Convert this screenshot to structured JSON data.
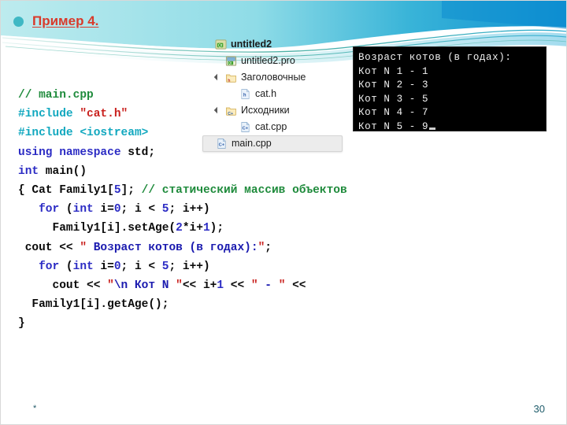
{
  "slide": {
    "title": "Пример 4.",
    "bullet_color": "#3FB8C4",
    "title_color": "#D93A2B",
    "footer_star": "*",
    "page_number": "30",
    "banner_colors": {
      "cyan_light": "#B7E9EC",
      "cyan_mid": "#34B9D6",
      "blue": "#0A8FD0",
      "teal_line": "#1F9E8F"
    }
  },
  "code": {
    "language": "cpp",
    "lines": [
      [
        {
          "t": "// main.cpp",
          "c": "c-comment"
        }
      ],
      [
        {
          "t": "#include ",
          "c": "c-pre"
        },
        {
          "t": "\"cat.h\"",
          "c": "c-str"
        }
      ],
      [
        {
          "t": "#include ",
          "c": "c-pre"
        },
        {
          "t": "<iostream>",
          "c": "c-pre"
        }
      ],
      [
        {
          "t": "using namespace ",
          "c": "c-kw"
        },
        {
          "t": "std;",
          "c": "c-plain"
        }
      ],
      [
        {
          "t": "int",
          "c": "c-kw"
        },
        {
          "t": " main()",
          "c": "c-plain"
        }
      ],
      [
        {
          "t": "{ Cat Family1[",
          "c": "c-plain"
        },
        {
          "t": "5",
          "c": "c-num"
        },
        {
          "t": "]; ",
          "c": "c-plain"
        },
        {
          "t": "// статический массив объектов",
          "c": "c-comment"
        }
      ],
      [
        {
          "t": "   ",
          "c": "c-plain"
        },
        {
          "t": "for",
          "c": "c-kw"
        },
        {
          "t": " (",
          "c": "c-plain"
        },
        {
          "t": "int",
          "c": "c-kw"
        },
        {
          "t": " i=",
          "c": "c-plain"
        },
        {
          "t": "0",
          "c": "c-num"
        },
        {
          "t": "; i < ",
          "c": "c-plain"
        },
        {
          "t": "5",
          "c": "c-num"
        },
        {
          "t": "; i++)",
          "c": "c-plain"
        }
      ],
      [
        {
          "t": "     Family1[i].setAge(",
          "c": "c-plain"
        },
        {
          "t": "2",
          "c": "c-num"
        },
        {
          "t": "*i+",
          "c": "c-plain"
        },
        {
          "t": "1",
          "c": "c-num"
        },
        {
          "t": ");",
          "c": "c-plain"
        }
      ],
      [
        {
          "t": " cout << ",
          "c": "c-plain"
        },
        {
          "t": "\"",
          "c": "c-str"
        },
        {
          "t": " Возраст котов (в годах):",
          "c": "c-strtxt"
        },
        {
          "t": "\"",
          "c": "c-str"
        },
        {
          "t": ";",
          "c": "c-plain"
        }
      ],
      [
        {
          "t": "   ",
          "c": "c-plain"
        },
        {
          "t": "for",
          "c": "c-kw"
        },
        {
          "t": " (",
          "c": "c-plain"
        },
        {
          "t": "int",
          "c": "c-kw"
        },
        {
          "t": " i=",
          "c": "c-plain"
        },
        {
          "t": "0",
          "c": "c-num"
        },
        {
          "t": "; i < ",
          "c": "c-plain"
        },
        {
          "t": "5",
          "c": "c-num"
        },
        {
          "t": "; i++)",
          "c": "c-plain"
        }
      ],
      [
        {
          "t": "     cout << ",
          "c": "c-plain"
        },
        {
          "t": "\"",
          "c": "c-str"
        },
        {
          "t": "\\n Кот N ",
          "c": "c-strtxt"
        },
        {
          "t": "\"",
          "c": "c-str"
        },
        {
          "t": "<< i+",
          "c": "c-plain"
        },
        {
          "t": "1",
          "c": "c-num"
        },
        {
          "t": " << ",
          "c": "c-plain"
        },
        {
          "t": "\"",
          "c": "c-str"
        },
        {
          "t": " - ",
          "c": "c-strtxt"
        },
        {
          "t": "\"",
          "c": "c-str"
        },
        {
          "t": " <<",
          "c": "c-plain"
        }
      ],
      [
        {
          "t": "  Family1[i].getAge();",
          "c": "c-plain"
        }
      ],
      [
        {
          "t": "}",
          "c": "c-plain"
        }
      ]
    ]
  },
  "project_tree": {
    "nodes": [
      {
        "label": "untitled2",
        "icon": "qt-project-icon",
        "indent": 0,
        "arrow": false,
        "bold": true,
        "selected": false
      },
      {
        "label": "untitled2.pro",
        "icon": "pro-file-icon",
        "indent": 1,
        "arrow": false,
        "bold": false,
        "selected": false
      },
      {
        "label": "Заголовочные",
        "icon": "folder-h-icon",
        "indent": 1,
        "arrow": true,
        "bold": false,
        "selected": false
      },
      {
        "label": "cat.h",
        "icon": "header-file-icon",
        "indent": 2,
        "arrow": false,
        "bold": false,
        "selected": false
      },
      {
        "label": "Исходники",
        "icon": "folder-cpp-icon",
        "indent": 1,
        "arrow": true,
        "bold": false,
        "selected": false
      },
      {
        "label": "cat.cpp",
        "icon": "cpp-file-icon",
        "indent": 2,
        "arrow": false,
        "bold": false,
        "selected": false
      },
      {
        "label": "main.cpp",
        "icon": "cpp-file-icon",
        "indent": 2,
        "arrow": false,
        "bold": false,
        "selected": true
      }
    ]
  },
  "console": {
    "title_line": "Возраст котов (в годах):",
    "lines": [
      "Возраст котов (в годах):",
      "Кот N 1 - 1",
      "Кот N 2 - 3",
      "Кот N 3 - 5",
      "Кот N 4 - 7",
      "Кот N 5 - 9"
    ],
    "cats": [
      {
        "n": 1,
        "age": 1
      },
      {
        "n": 2,
        "age": 3
      },
      {
        "n": 3,
        "age": 5
      },
      {
        "n": 4,
        "age": 7
      },
      {
        "n": 5,
        "age": 9
      }
    ],
    "background": "#000000",
    "foreground": "#f2f2f2"
  }
}
